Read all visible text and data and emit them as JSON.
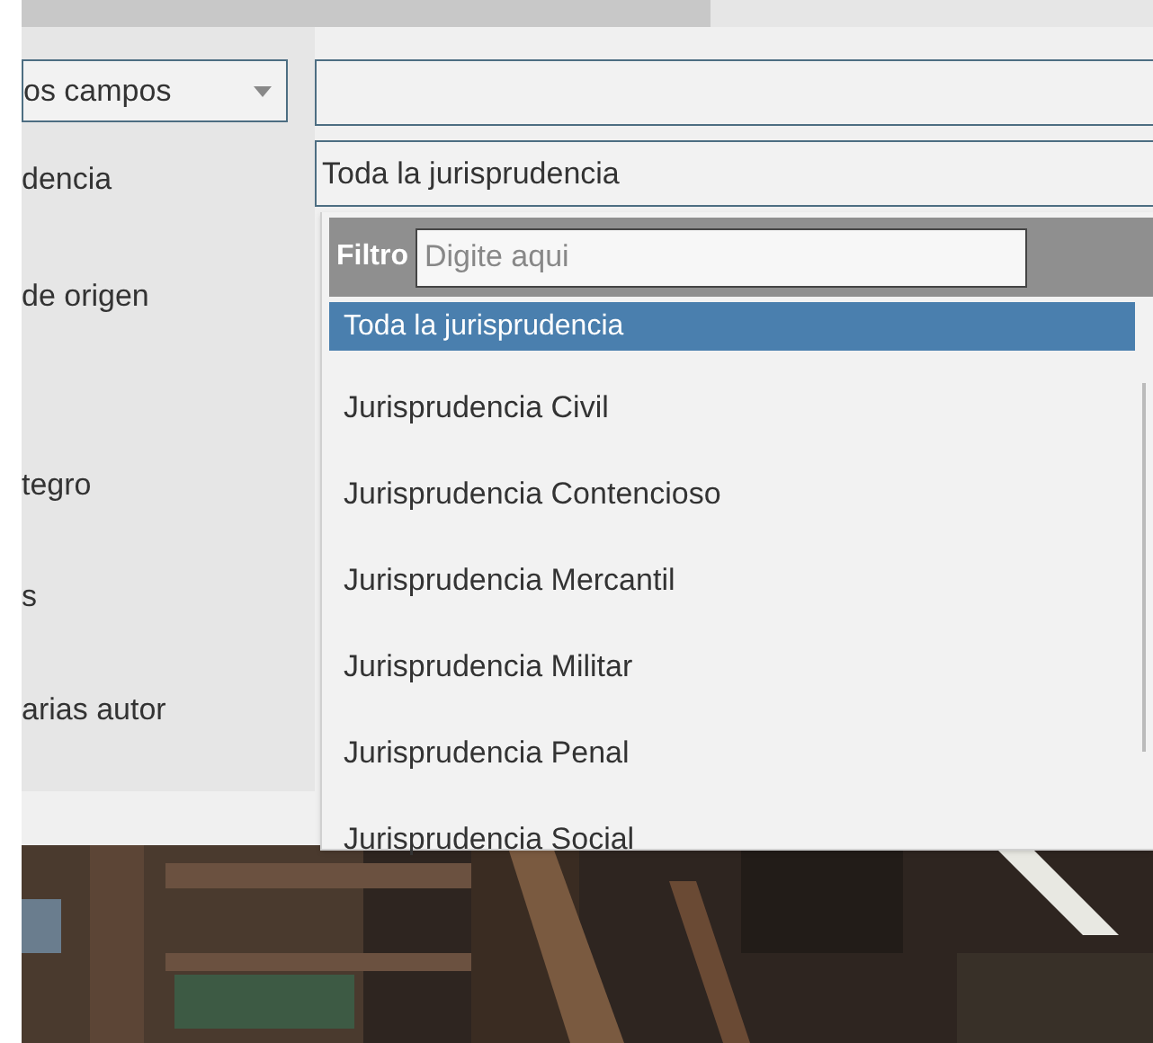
{
  "search_row": {
    "field_select": "os campos"
  },
  "fields": [
    {
      "label": "dencia"
    },
    {
      "label": "de origen"
    },
    {
      "label": "tegro"
    },
    {
      "label": "s"
    },
    {
      "label": "arias autor"
    }
  ],
  "jurisprudence_select": {
    "value": "Toda la jurisprudencia",
    "dropdown": {
      "filter_label": "Filtro",
      "filter_placeholder": "Digite aqui",
      "options": [
        {
          "label": "Toda la jurisprudencia",
          "selected": true
        },
        {
          "label": "Jurisprudencia Civil",
          "selected": false
        },
        {
          "label": "Jurisprudencia Contencioso",
          "selected": false
        },
        {
          "label": "Jurisprudencia Mercantil",
          "selected": false
        },
        {
          "label": "Jurisprudencia Militar",
          "selected": false
        },
        {
          "label": "Jurisprudencia Penal",
          "selected": false
        },
        {
          "label": "Jurisprudencia Social",
          "selected": false
        }
      ]
    }
  }
}
